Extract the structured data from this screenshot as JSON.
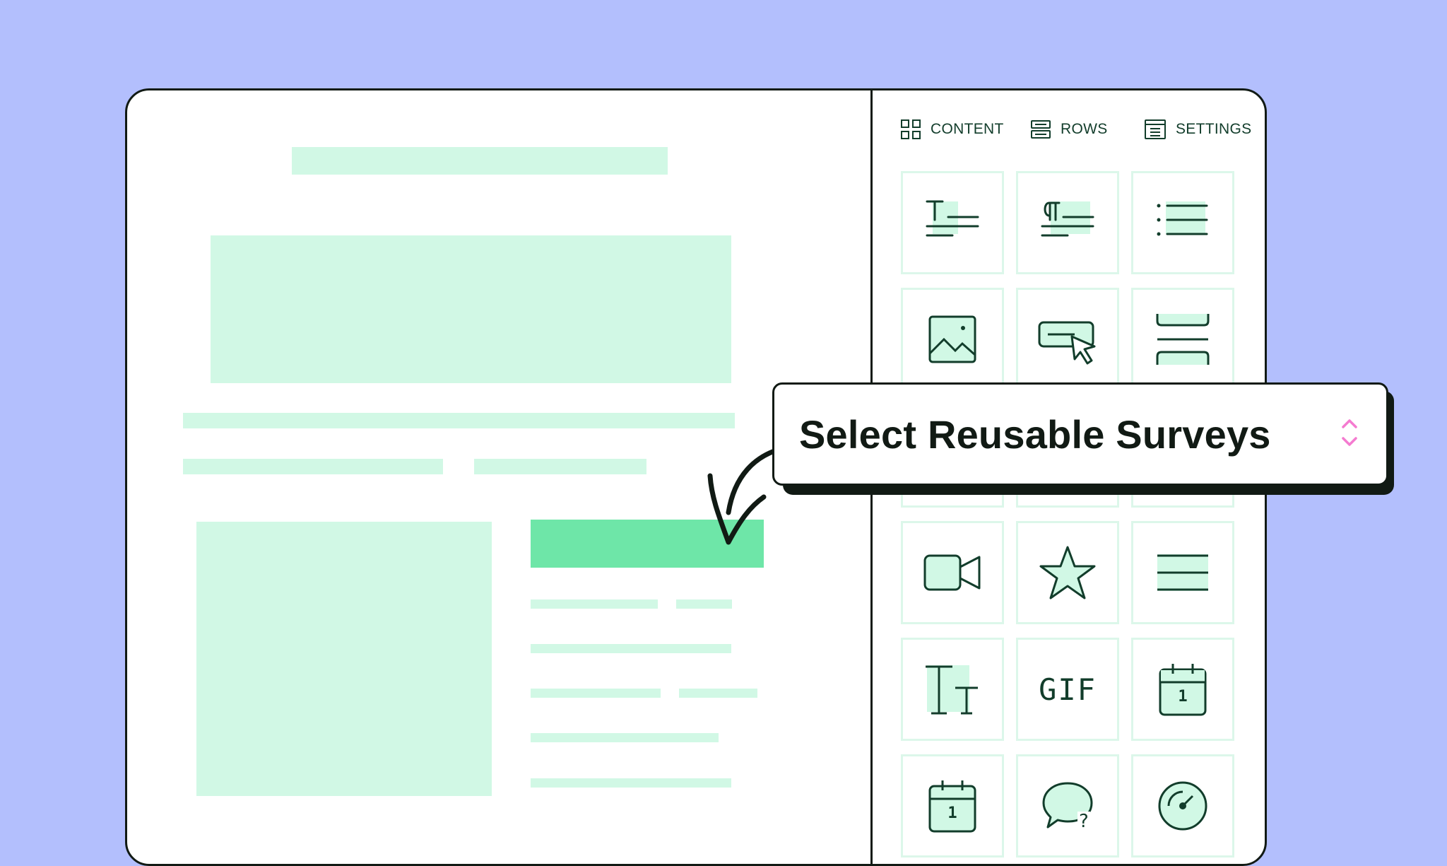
{
  "panel": {
    "tabs": [
      {
        "label": "CONTENT",
        "icon": "grid-icon"
      },
      {
        "label": "ROWS",
        "icon": "rows-icon"
      },
      {
        "label": "SETTINGS",
        "icon": "settings-icon"
      }
    ],
    "tiles": [
      {
        "icon": "heading-icon"
      },
      {
        "icon": "paragraph-icon"
      },
      {
        "icon": "list-icon"
      },
      {
        "icon": "image-icon"
      },
      {
        "icon": "button-icon"
      },
      {
        "icon": "spacer-icon"
      },
      {
        "icon": "video-icon"
      },
      {
        "icon": "star-icon"
      },
      {
        "icon": "divider-lines-icon"
      },
      {
        "icon": "text-size-icon"
      },
      {
        "icon": "gif-icon",
        "label": "GIF"
      },
      {
        "icon": "calendar-icon",
        "label": "1"
      },
      {
        "icon": "calendar-icon",
        "label": "1"
      },
      {
        "icon": "chat-question-icon",
        "label": "?"
      },
      {
        "icon": "gauge-icon"
      }
    ]
  },
  "dropdown": {
    "selected": "Select Reusable Surveys",
    "icon": "chevron-up-down-icon"
  },
  "colors": {
    "background": "#b3bffd",
    "placeholder": "#d1f8e5",
    "cta": "#6ee6a8",
    "icon": "#123d2b",
    "chevron": "#f47bd0",
    "outline": "#111a14"
  }
}
